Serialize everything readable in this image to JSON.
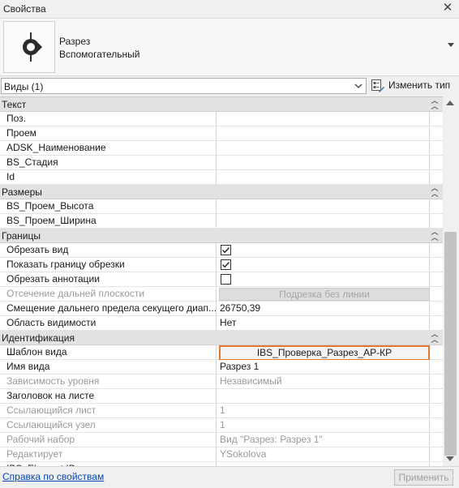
{
  "window": {
    "title": "Свойства",
    "close_glyph": "✕"
  },
  "type_selector": {
    "line1": "Разрез",
    "line2": "Вспомогательный",
    "icon": "section-view-icon"
  },
  "filter": {
    "value": "Виды (1)",
    "edit_type_label": "Изменить тип"
  },
  "groups": [
    {
      "name": "Текст",
      "rows": [
        {
          "name": "Поз.",
          "value": ""
        },
        {
          "name": "Проем",
          "value": ""
        },
        {
          "name": "ADSK_Наименование",
          "value": ""
        },
        {
          "name": "BS_Стадия",
          "value": ""
        },
        {
          "name": "Id",
          "value": ""
        }
      ]
    },
    {
      "name": "Размеры",
      "rows": [
        {
          "name": "BS_Проем_Высота",
          "value": ""
        },
        {
          "name": "BS_Проем_Ширина",
          "value": ""
        }
      ]
    },
    {
      "name": "Границы",
      "rows": [
        {
          "name": "Обрезать вид",
          "type": "checkbox",
          "checked": true
        },
        {
          "name": "Показать границу обрезки",
          "type": "checkbox",
          "checked": true
        },
        {
          "name": "Обрезать аннотации",
          "type": "checkbox",
          "checked": false
        },
        {
          "name": "Отсечение дальней плоскости",
          "type": "button",
          "value": "Подрезка без линии",
          "disabled": true
        },
        {
          "name": "Смещение дальнего предела секущего диап...",
          "value": "26750,39"
        },
        {
          "name": "Область видимости",
          "value": "Нет"
        }
      ]
    },
    {
      "name": "Идентификация",
      "rows": [
        {
          "name": "Шаблон вида",
          "type": "button",
          "value": "IBS_Проверка_Разрез_АР-КР",
          "highlight": true
        },
        {
          "name": "Имя вида",
          "value": "Разрез 1"
        },
        {
          "name": "Зависимость уровня",
          "value": "Независимый",
          "disabled": true
        },
        {
          "name": "Заголовок на листе",
          "value": ""
        },
        {
          "name": "Ссылающийся лист",
          "value": "1",
          "disabled": true
        },
        {
          "name": "Ссылающийся узел",
          "value": "1",
          "disabled": true
        },
        {
          "name": "Рабочий набор",
          "value": "Вид \"Разрез: Разрез 1\"",
          "disabled": true
        },
        {
          "name": "Редактирует",
          "value": "YSokolova",
          "disabled": true
        },
        {
          "name": "IBS_Element ID",
          "value": ""
        }
      ]
    }
  ],
  "footer": {
    "help_link": "Справка по свойствам",
    "apply_label": "Применить"
  },
  "colors": {
    "highlight_border": "#e8772e",
    "link": "#0645ad",
    "group_header": "#e2e2e2"
  }
}
